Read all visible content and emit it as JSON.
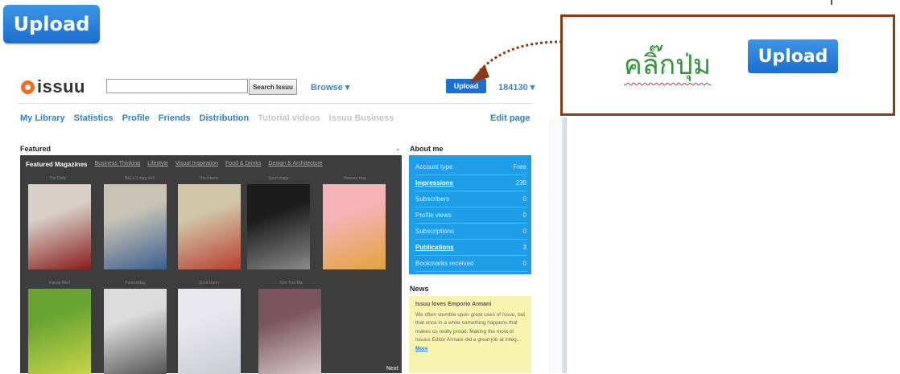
{
  "big_button": {
    "label": "Upload"
  },
  "callout": {
    "text": "คลิ๊กปุ่ม",
    "button_label": "Upload"
  },
  "site": {
    "logo_text": "issuu",
    "search_placeholder": "",
    "search_button": "Search Issuu",
    "browse": "Browse ▾",
    "upload": "Upload",
    "user": "184130 ▾",
    "nav": [
      "My Library",
      "Statistics",
      "Profile",
      "Friends",
      "Distribution",
      "Tutorial videos",
      "Issuu Business"
    ],
    "edit_page": "Edit page"
  },
  "featured": {
    "label": "Featured",
    "tabs": [
      "Featured Magazines",
      "Business Thinking",
      "Lifestyle",
      "Visual Inspiration",
      "Food & Drinks",
      "Design & Architecture"
    ],
    "magazines": [
      {
        "name": "The Daily",
        "c1": "#d8d0c8",
        "c2": "#8a1c1c"
      },
      {
        "name": "BELLO mag #43",
        "c1": "#c9c3b6",
        "c2": "#3b5f8f"
      },
      {
        "name": "The Hasnn",
        "c1": "#d2c6a8",
        "c2": "#b84030"
      },
      {
        "name": "Sport magz",
        "c1": "#1b1b1b",
        "c2": "#8a8a8a"
      },
      {
        "name": "Heaven Has",
        "c1": "#f4b3b6",
        "c2": "#e4a238"
      },
      {
        "name": "Kanoo Worl",
        "c1": "#6aa532",
        "c2": "#c9d44a"
      },
      {
        "name": "PureLeMag",
        "c1": "#dcdcdc",
        "c2": "#555555"
      },
      {
        "name": "Scott Dunn",
        "c1": "#e8e8ec",
        "c2": "#c9cbd4"
      },
      {
        "name": "Tom Tom Ma",
        "c1": "#7a5560",
        "c2": "#d8c8c8"
      }
    ],
    "next": "Next"
  },
  "about": {
    "label": "About me",
    "rows": [
      {
        "label": "Account type",
        "value": "Free",
        "link": false
      },
      {
        "label": "Impressions",
        "value": "239",
        "link": true
      },
      {
        "label": "Subscribers",
        "value": "0",
        "link": false
      },
      {
        "label": "Profile views",
        "value": "0",
        "link": false
      },
      {
        "label": "Subscriptions",
        "value": "0",
        "link": false
      },
      {
        "label": "Publications",
        "value": "3",
        "link": true
      },
      {
        "label": "Bookmarks received",
        "value": "0",
        "link": false
      }
    ]
  },
  "news": {
    "label": "News",
    "title": "Issuu loves Emporio Armani",
    "body": "We often stumble upon great uses of Issuu, but that once in a while something happens that makes us really proud. Making the most of Issuus Editor Armani did a great job at integ...",
    "more": "More"
  },
  "colors": {
    "accent": "#1b6fcf",
    "callout_border": "#8f3b12",
    "callout_text": "#2f9a3a",
    "about_bg": "#1e9ee8",
    "news_bg": "#f8f4b0",
    "logo": "#f36d21"
  }
}
